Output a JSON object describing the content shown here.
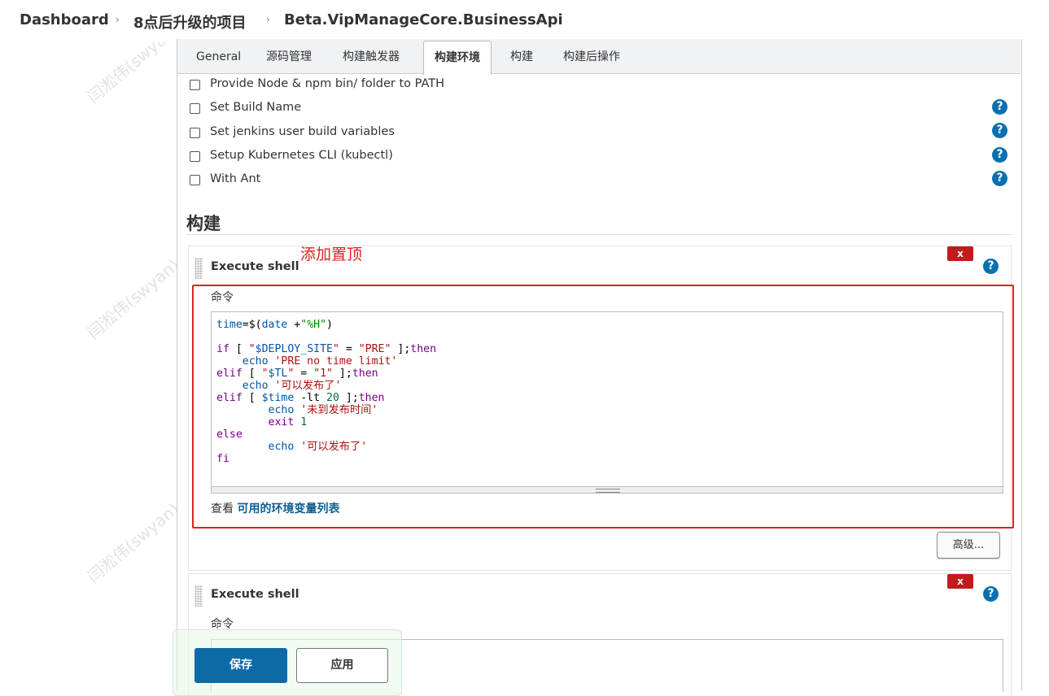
{
  "breadcrumb": {
    "items": [
      "Dashboard",
      "8点后升级的项目",
      "Beta.VipManageCore.BusinessApi"
    ],
    "separator": "›"
  },
  "tabs": [
    {
      "label": "General"
    },
    {
      "label": "源码管理"
    },
    {
      "label": "构建触发器"
    },
    {
      "label": "构建环境",
      "active": true
    },
    {
      "label": "构建"
    },
    {
      "label": "构建后操作"
    }
  ],
  "build_env_options": [
    {
      "label": "Provide Node & npm bin/ folder to PATH",
      "checked": false
    },
    {
      "label": "Set Build Name",
      "checked": false
    },
    {
      "label": "Set jenkins user build variables",
      "checked": false
    },
    {
      "label": "Setup Kubernetes CLI (kubectl)",
      "checked": false
    },
    {
      "label": "With Ant",
      "checked": false
    }
  ],
  "help_icon": "?",
  "build_section": {
    "title": "构建",
    "annotation": "添加置顶",
    "steps": [
      {
        "title": "Execute shell",
        "delete_label": "x",
        "command_label": "命令",
        "command": "time=$(date +\"%H\")\n\nif [ \"$DEPLOY_SITE\" = \"PRE\" ];then\n    echo 'PRE no time limit'\nelif [ \"$TL\" = \"1\" ];then\n    echo '可以发布了'\nelif [ $time -lt 20 ];then\n        echo '未到发布时间'\n        exit 1\nelse\n        echo '可以发布了'\nfi",
        "env_link_prefix": "查看",
        "env_link_text": "可用的环境变量列表",
        "advanced_label": "高级..."
      },
      {
        "title": "Execute shell",
        "delete_label": "x",
        "command_label": "命令"
      }
    ]
  },
  "actions": {
    "save_label": "保存",
    "apply_label": "应用"
  },
  "watermark_text": "闫淞伟(swyan)",
  "colors": {
    "accent": "#0b6fb0",
    "delete": "#c21b1b",
    "annotation": "#e0201e",
    "save": "#0e6aa7"
  }
}
